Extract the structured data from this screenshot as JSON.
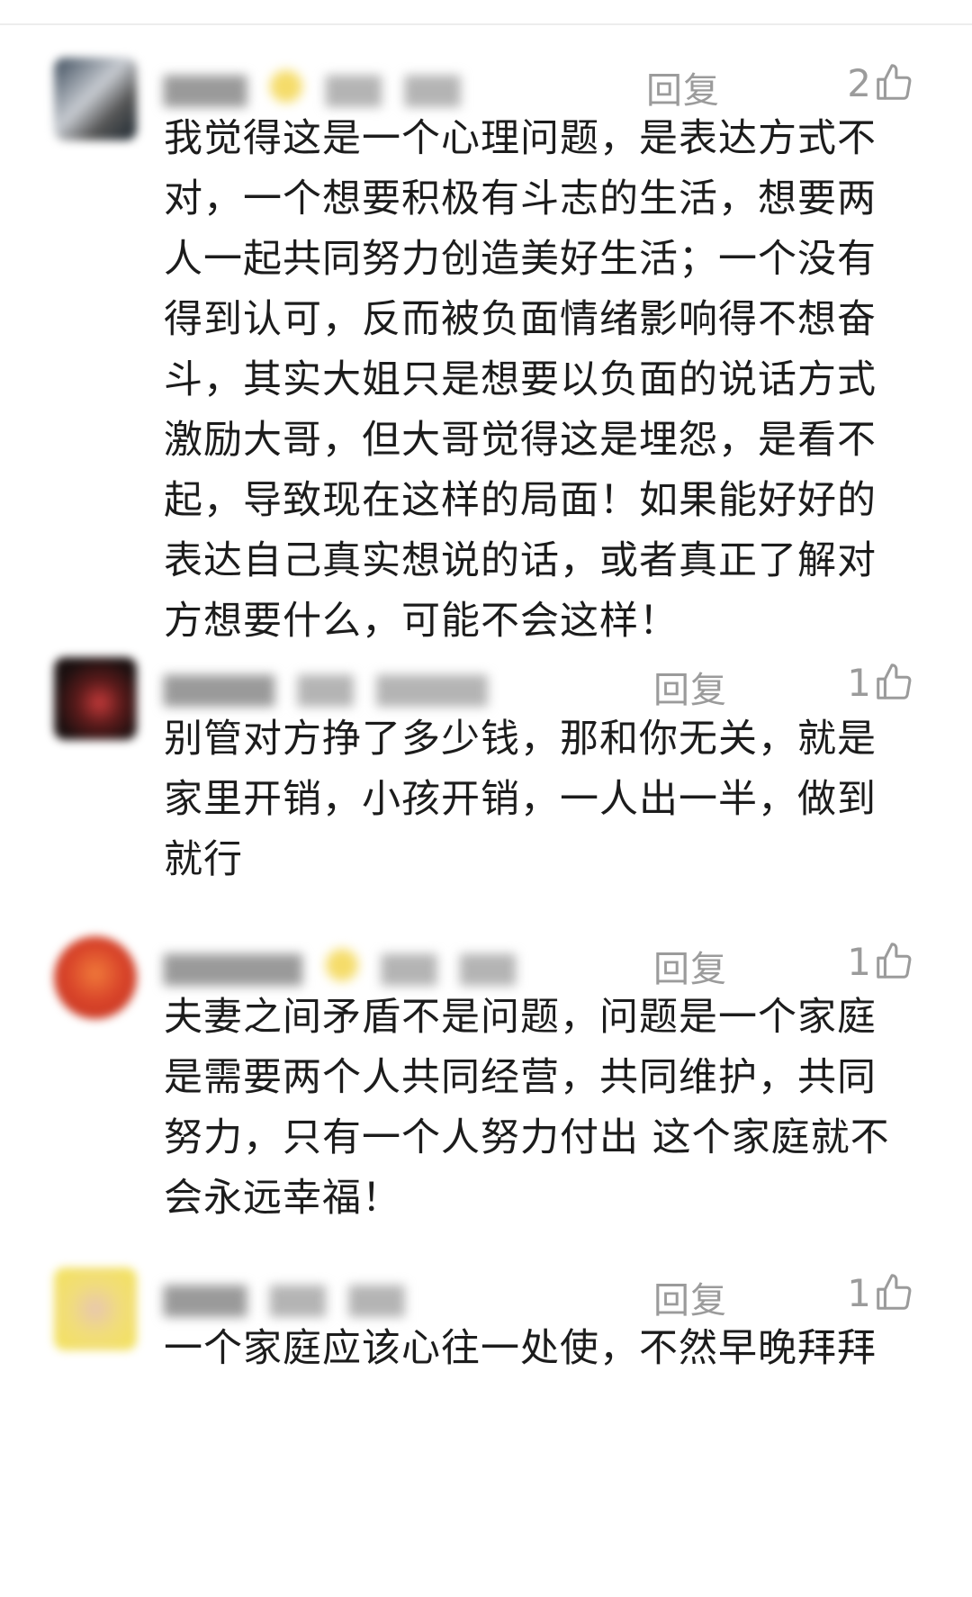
{
  "comments": [
    {
      "reply_label": "回复",
      "like_count": "2",
      "text": "我觉得这是一个心理问题，是表达方式不对，一个想要积极有斗志的生活，想要两人一起共同努力创造美好生活；一个没有得到认可，反而被负面情绪影响得不想奋斗，其实大姐只是想要以负面的说话方式激励大哥，但大哥觉得这是埋怨，是看不起，导致现在这样的局面！如果能好好的表达自己真实想说的话，或者真正了解对方想要什么，可能不会这样！"
    },
    {
      "reply_label": "回复",
      "like_count": "1",
      "text": "别管对方挣了多少钱，那和你无关，就是家里开销，小孩开销，一人出一半，做到就行"
    },
    {
      "reply_label": "回复",
      "like_count": "1",
      "text": "夫妻之间矛盾不是问题，问题是一个家庭是需要两个人共同经营，共同维护，共同努力，只有一个人努力付出 这个家庭就不会永远幸福！"
    },
    {
      "reply_label": "回复",
      "like_count": "1",
      "text": "一个家庭应该心往一处使，不然早晚拜拜"
    }
  ],
  "icons": {
    "like": "thumbs-up-icon"
  },
  "colors": {
    "muted": "#9b9b9b",
    "text": "#1c1c1c"
  }
}
